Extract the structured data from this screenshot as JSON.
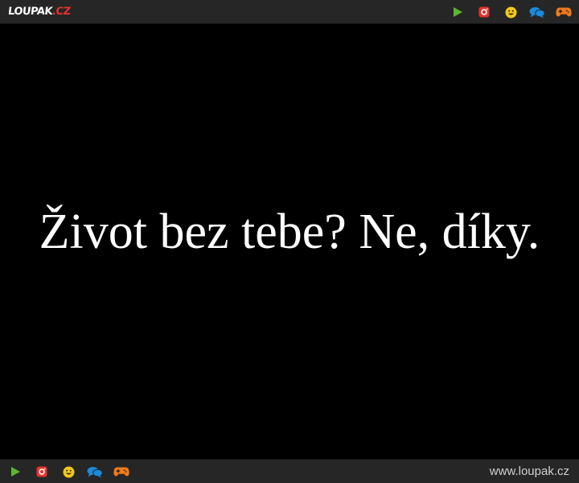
{
  "header": {
    "logo_main": "LOUPAK",
    "logo_tld": ".CZ",
    "icons": [
      "play-icon",
      "instagram-icon",
      "smiley-icon",
      "chat-icon",
      "gamepad-icon"
    ]
  },
  "main": {
    "quote": "Život bez tebe? Ne, díky."
  },
  "footer": {
    "url": "www.loupak.cz",
    "icons": [
      "play-icon",
      "instagram-icon",
      "smiley-icon",
      "chat-icon",
      "gamepad-icon"
    ]
  },
  "colors": {
    "bar_background": "#262626",
    "page_background": "#000000",
    "play_green": "#5bb82e",
    "instagram_red": "#e5322e",
    "smiley_yellow": "#f3c81c",
    "chat_blue": "#1b8ad8",
    "gamepad_orange": "#f07a1a"
  }
}
